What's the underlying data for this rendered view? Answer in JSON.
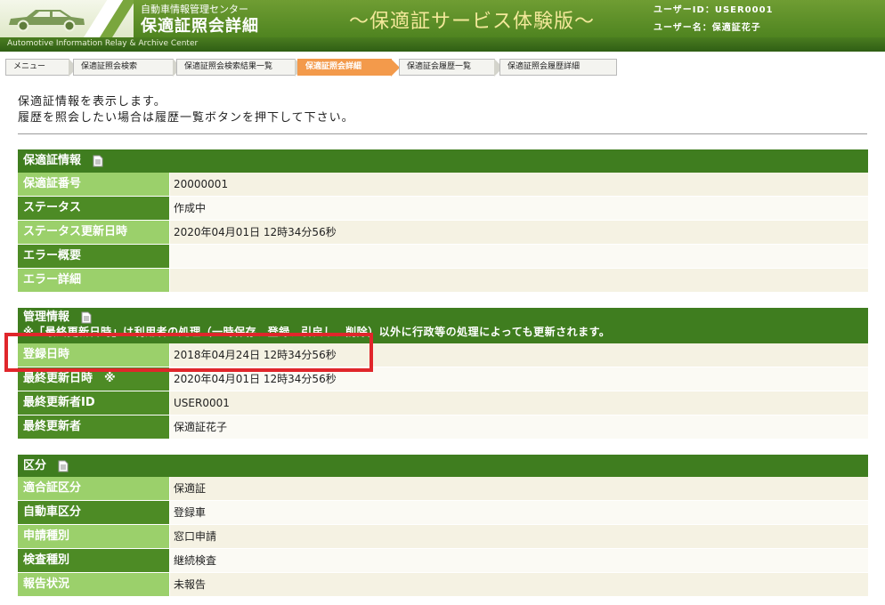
{
  "header": {
    "org_name": "自動車情報管理センター",
    "screen_title": "保適証照会詳細",
    "demo_title": "～保適証サービス体験版～",
    "user_id": "ユーザーID：USER0001",
    "user_name": "ユーザー名：保適証花子",
    "sub_banner": "Automotive Information Relay & Archive Center"
  },
  "breadcrumb": [
    {
      "label": "メニュー",
      "active": false
    },
    {
      "label": "保適証照会検索",
      "active": false
    },
    {
      "label": "保適証照会検索結果一覧",
      "active": false
    },
    {
      "label": "保適証照会詳細",
      "active": true
    },
    {
      "label": "保適証会履歴一覧",
      "active": false
    },
    {
      "label": "保適証照会履歴詳細",
      "active": false
    }
  ],
  "intro": {
    "line1": "保適証情報を表示します。",
    "line2": "履歴を照会したい場合は履歴一覧ボタンを押下して下さい。"
  },
  "sections": {
    "info": {
      "title": "保適証情報",
      "rows": [
        {
          "label": "保適証番号",
          "value": "20000001"
        },
        {
          "label": "ステータス",
          "value": "作成中"
        },
        {
          "label": "ステータス更新日時",
          "value": "2020年04月01日 12時34分56秒"
        },
        {
          "label": "エラー概要",
          "value": ""
        },
        {
          "label": "エラー詳細",
          "value": ""
        }
      ]
    },
    "mgmt": {
      "title": "管理情報",
      "note": "※「最終更新日時」は利用者の処理（一時保存、登録、引戻し、削除）以外に行政等の処理によっても更新されます。",
      "rows": [
        {
          "label": "登録日時",
          "value": "2018年04月24日 12時34分56秒"
        },
        {
          "label": "最終更新日時　※",
          "value": "2020年04月01日 12時34分56秒"
        },
        {
          "label": "最終更新者ID",
          "value": "USER0001"
        },
        {
          "label": "最終更新者",
          "value": "保適証花子"
        }
      ]
    },
    "category": {
      "title": "区分",
      "rows": [
        {
          "label": "適合証区分",
          "value": "保適証"
        },
        {
          "label": "自動車区分",
          "value": "登録車"
        },
        {
          "label": "申請種別",
          "value": "窓口申請"
        },
        {
          "label": "検査種別",
          "value": "継続検査"
        },
        {
          "label": "報告状況",
          "value": "未報告"
        }
      ]
    }
  },
  "colors": {
    "header_green": "#4f8420",
    "section_header": "#3f7d1f",
    "label_light": "#9bd06b",
    "label_dark": "#4d8b25",
    "active_crumb": "#f39a4b",
    "highlight": "#e0262b"
  }
}
